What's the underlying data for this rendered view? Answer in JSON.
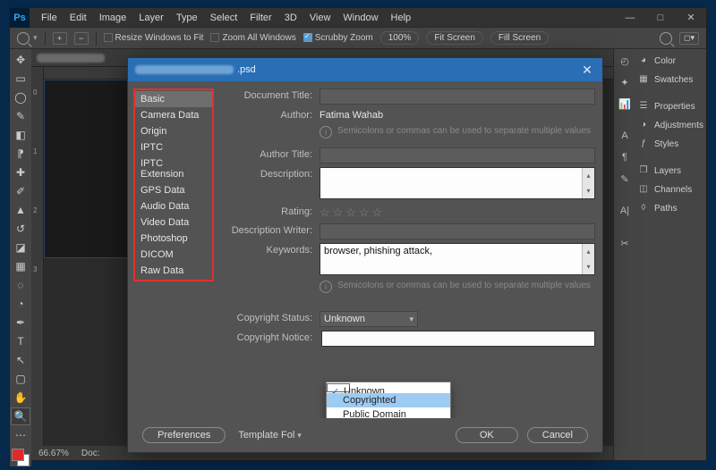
{
  "menus": [
    "File",
    "Edit",
    "Image",
    "Layer",
    "Type",
    "Select",
    "Filter",
    "3D",
    "View",
    "Window",
    "Help"
  ],
  "optbar": {
    "resize_label": "Resize Windows to Fit",
    "zoom_all_label": "Zoom All Windows",
    "scrubby_label": "Scrubby Zoom",
    "zoom_pct": "100%",
    "fit_screen": "Fit Screen",
    "fill_screen": "Fill Screen"
  },
  "status": {
    "zoom": "66.67%",
    "doc_label": "Doc:"
  },
  "right_panels": {
    "group1": [
      "Color",
      "Swatches"
    ],
    "group2": [
      "Properties",
      "Adjustments",
      "Styles"
    ],
    "group3": [
      "Layers",
      "Channels",
      "Paths"
    ]
  },
  "modal": {
    "title_ext": ".psd",
    "categories": [
      "Basic",
      "Camera Data",
      "Origin",
      "IPTC",
      "IPTC Extension",
      "GPS Data",
      "Audio Data",
      "Video Data",
      "Photoshop",
      "DICOM",
      "Raw Data"
    ],
    "active_category": "Basic",
    "labels": {
      "doc_title": "Document Title:",
      "author": "Author:",
      "author_title": "Author Title:",
      "description": "Description:",
      "rating": "Rating:",
      "desc_writer": "Description Writer:",
      "keywords": "Keywords:",
      "copyright_status": "Copyright Status:",
      "copyright_notice": "Copyright Notice:"
    },
    "values": {
      "doc_title": "",
      "author": "Fatima Wahab",
      "author_title": "",
      "description": "",
      "desc_writer": "",
      "keywords": "browser, phishing attack,",
      "copyright_status": "Unknown",
      "copyright_notice": ""
    },
    "hint_text": "Semicolons or commas can be used to separate multiple values",
    "dropdown_options": [
      "Unknown",
      "Copyrighted",
      "Public Domain"
    ],
    "dropdown_selected": "Unknown",
    "dropdown_hover": "Copyrighted",
    "footer": {
      "preferences": "Preferences",
      "template_label": "Template Fol",
      "ok": "OK",
      "cancel": "Cancel"
    }
  }
}
